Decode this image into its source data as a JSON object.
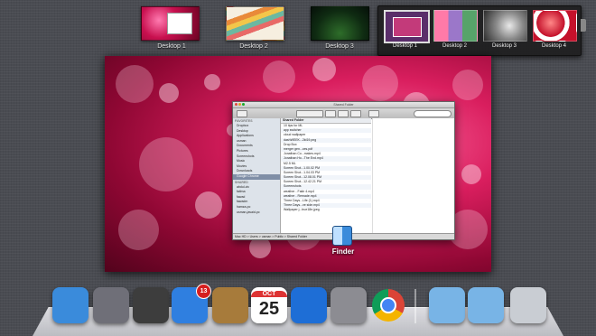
{
  "desktops": {
    "thumbs": [
      {
        "label": "Desktop 1"
      },
      {
        "label": "Desktop 2"
      },
      {
        "label": "Desktop 3"
      }
    ]
  },
  "overlay": {
    "items": [
      {
        "label": "Desktop 1"
      },
      {
        "label": "Desktop 2"
      },
      {
        "label": "Desktop 3"
      },
      {
        "label": "Desktop 4"
      }
    ]
  },
  "finder_window": {
    "title": "Shared Folder",
    "column_header": "Shared Folder",
    "sidebar": {
      "favorites_heading": "FAVORITES",
      "favorites": [
        "Dropbox",
        "Desktop",
        "Applications",
        "usman",
        "Documents",
        "Pictures",
        "Screenshots",
        "Music",
        "Movies",
        "Downloads",
        "Google Chrome"
      ],
      "shared_heading": "SHARED",
      "shared": [
        "abdul-vic",
        "fatima",
        "fawad",
        "fawadm",
        "hamza-pc",
        "usman-javaid-pc"
      ]
    },
    "files": [
      "10 tips for ML",
      "app switcher",
      "cloud wallpaper",
      "dashWEEK...2ld19.png",
      "Drop Box",
      "merger gen...ces.pdf",
      "Jonathan Co...makes.mp4",
      "Jonathan Ho...The End.mp4",
      "M2.5 ML",
      "Screen Shot...1.00.02 PM",
      "Screen Shot...1.04.03 PM",
      "Screen Shot...12.08.01 PM",
      "Screen Shot...12.42.21 PM",
      "Screenshots",
      "weather - Fakir 4.mp4",
      "weather - Remade.mp4",
      "Three Days...Life (1).mp4",
      "Three Days...ve side.mp4",
      "Wallpaper j...true18e.jpeg"
    ],
    "status": "Mac HD > Users > usman > Public > Shared Folder"
  },
  "active_app_label": "Finder",
  "dock": {
    "items": [
      {
        "name": "finder",
        "color": "#3a8bdb"
      },
      {
        "name": "launchpad",
        "color": "#6f6f78"
      },
      {
        "name": "photos",
        "color": "#3d3d3d"
      },
      {
        "name": "app-store",
        "color": "#2f7fe0",
        "badge": "13"
      },
      {
        "name": "contacts",
        "color": "#a77b3b"
      },
      {
        "name": "calendar",
        "month": "OCT",
        "day": "25",
        "color": "#ffffff"
      },
      {
        "name": "itunes",
        "color": "#1e6ed6"
      },
      {
        "name": "system-preferences",
        "color": "#8c8c92"
      },
      {
        "name": "chrome",
        "color": "#ffffff"
      },
      {
        "name": "applications-folder",
        "color": "#78b4e6"
      },
      {
        "name": "documents-folder",
        "color": "#78b4e6"
      },
      {
        "name": "trash",
        "color": "#c9cdd3"
      }
    ]
  }
}
